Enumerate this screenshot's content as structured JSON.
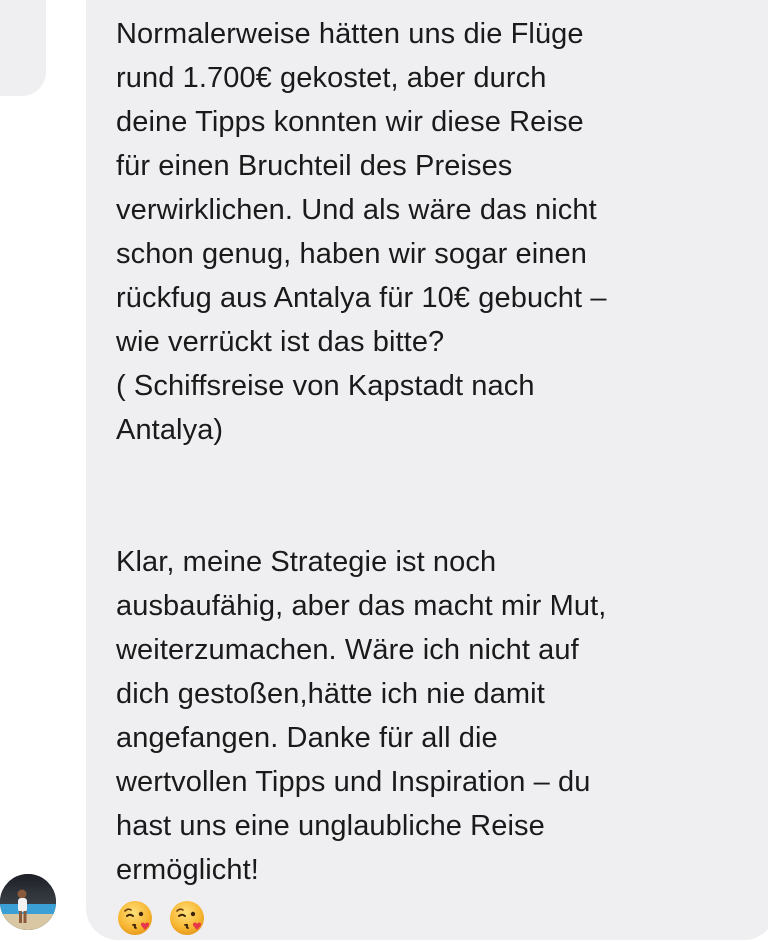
{
  "conversation": {
    "message": {
      "paragraph_1_lines": [
        "Normalerweise hätten uns die Flüge",
        "rund 1.700€ gekostet, aber durch",
        "deine Tipps konnten wir diese Reise",
        "für einen Bruchteil des Preises",
        "verwirklichen. Und als wäre das nicht",
        "schon genug, haben wir sogar einen",
        "rückfug aus Antalya für 10€ gebucht –",
        "wie verrückt ist das bitte?",
        "( Schiffsreise von Kapstadt nach",
        "Antalya)"
      ],
      "paragraph_2_lines": [
        "Klar, meine Strategie ist noch",
        "ausbaufähig, aber das macht mir Mut,",
        "weiterzumachen. Wäre ich nicht auf",
        "dich gestoßen,hätte ich nie damit",
        "angefangen. Danke für all die",
        "wertvollen Tipps und Inspiration – du",
        "hast uns eine unglaubliche Reise",
        "ermöglicht!"
      ],
      "emojis": [
        "kissing-face-with-heart-icon",
        "kissing-face-with-heart-icon"
      ]
    },
    "colors": {
      "bubble": "#efeff1",
      "text": "#1a1a1a",
      "emoji_face": "#f7b733",
      "heart": "#e8374a"
    }
  }
}
